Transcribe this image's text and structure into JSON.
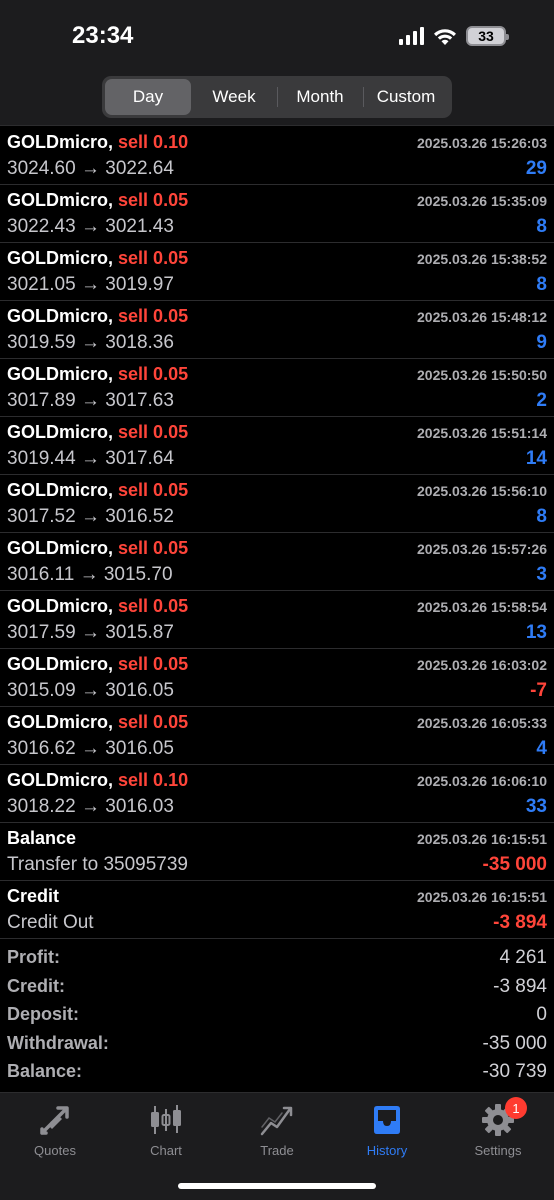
{
  "status": {
    "time": "23:34",
    "battery": "33"
  },
  "periods": [
    "Day",
    "Week",
    "Month",
    "Custom"
  ],
  "active_period": "Day",
  "trades": [
    {
      "symbol": "GOLDmicro,",
      "side": "sell 0.10",
      "date": "2025.03.26 15:26:03",
      "price_open": "3024.60",
      "price_close": "3022.64",
      "profit": "29"
    },
    {
      "symbol": "GOLDmicro,",
      "side": "sell 0.05",
      "date": "2025.03.26 15:35:09",
      "price_open": "3022.43",
      "price_close": "3021.43",
      "profit": "8"
    },
    {
      "symbol": "GOLDmicro,",
      "side": "sell 0.05",
      "date": "2025.03.26 15:38:52",
      "price_open": "3021.05",
      "price_close": "3019.97",
      "profit": "8"
    },
    {
      "symbol": "GOLDmicro,",
      "side": "sell 0.05",
      "date": "2025.03.26 15:48:12",
      "price_open": "3019.59",
      "price_close": "3018.36",
      "profit": "9"
    },
    {
      "symbol": "GOLDmicro,",
      "side": "sell 0.05",
      "date": "2025.03.26 15:50:50",
      "price_open": "3017.89",
      "price_close": "3017.63",
      "profit": "2"
    },
    {
      "symbol": "GOLDmicro,",
      "side": "sell 0.05",
      "date": "2025.03.26 15:51:14",
      "price_open": "3019.44",
      "price_close": "3017.64",
      "profit": "14"
    },
    {
      "symbol": "GOLDmicro,",
      "side": "sell 0.05",
      "date": "2025.03.26 15:56:10",
      "price_open": "3017.52",
      "price_close": "3016.52",
      "profit": "8"
    },
    {
      "symbol": "GOLDmicro,",
      "side": "sell 0.05",
      "date": "2025.03.26 15:57:26",
      "price_open": "3016.11",
      "price_close": "3015.70",
      "profit": "3"
    },
    {
      "symbol": "GOLDmicro,",
      "side": "sell 0.05",
      "date": "2025.03.26 15:58:54",
      "price_open": "3017.59",
      "price_close": "3015.87",
      "profit": "13"
    },
    {
      "symbol": "GOLDmicro,",
      "side": "sell 0.05",
      "date": "2025.03.26 16:03:02",
      "price_open": "3015.09",
      "price_close": "3016.05",
      "profit": "-7"
    },
    {
      "symbol": "GOLDmicro,",
      "side": "sell 0.05",
      "date": "2025.03.26 16:05:33",
      "price_open": "3016.62",
      "price_close": "3016.05",
      "profit": "4"
    },
    {
      "symbol": "GOLDmicro,",
      "side": "sell 0.10",
      "date": "2025.03.26 16:06:10",
      "price_open": "3018.22",
      "price_close": "3016.03",
      "profit": "33"
    }
  ],
  "arrow": "→",
  "operations": [
    {
      "title": "Balance",
      "date": "2025.03.26 16:15:51",
      "comment": "Transfer to 35095739",
      "amount": "-35 000"
    },
    {
      "title": "Credit",
      "date": "2025.03.26 16:15:51",
      "comment": "Credit Out",
      "amount": "-3 894"
    }
  ],
  "summary": [
    {
      "label": "Profit:",
      "value": "4 261"
    },
    {
      "label": "Credit:",
      "value": "-3 894"
    },
    {
      "label": "Deposit:",
      "value": "0"
    },
    {
      "label": "Withdrawal:",
      "value": "-35 000"
    },
    {
      "label": "Balance:",
      "value": "-30 739"
    }
  ],
  "tabs": [
    {
      "label": "Quotes",
      "icon": "quotes-arrows-icon"
    },
    {
      "label": "Chart",
      "icon": "candlestick-icon"
    },
    {
      "label": "Trade",
      "icon": "trade-chart-icon"
    },
    {
      "label": "History",
      "icon": "inbox-icon"
    },
    {
      "label": "Settings",
      "icon": "gear-icon"
    }
  ],
  "active_tab": "History",
  "settings_badge": "1",
  "colors": {
    "accent": "#2f7cf6",
    "loss": "#ff453a",
    "background": "#000000"
  }
}
